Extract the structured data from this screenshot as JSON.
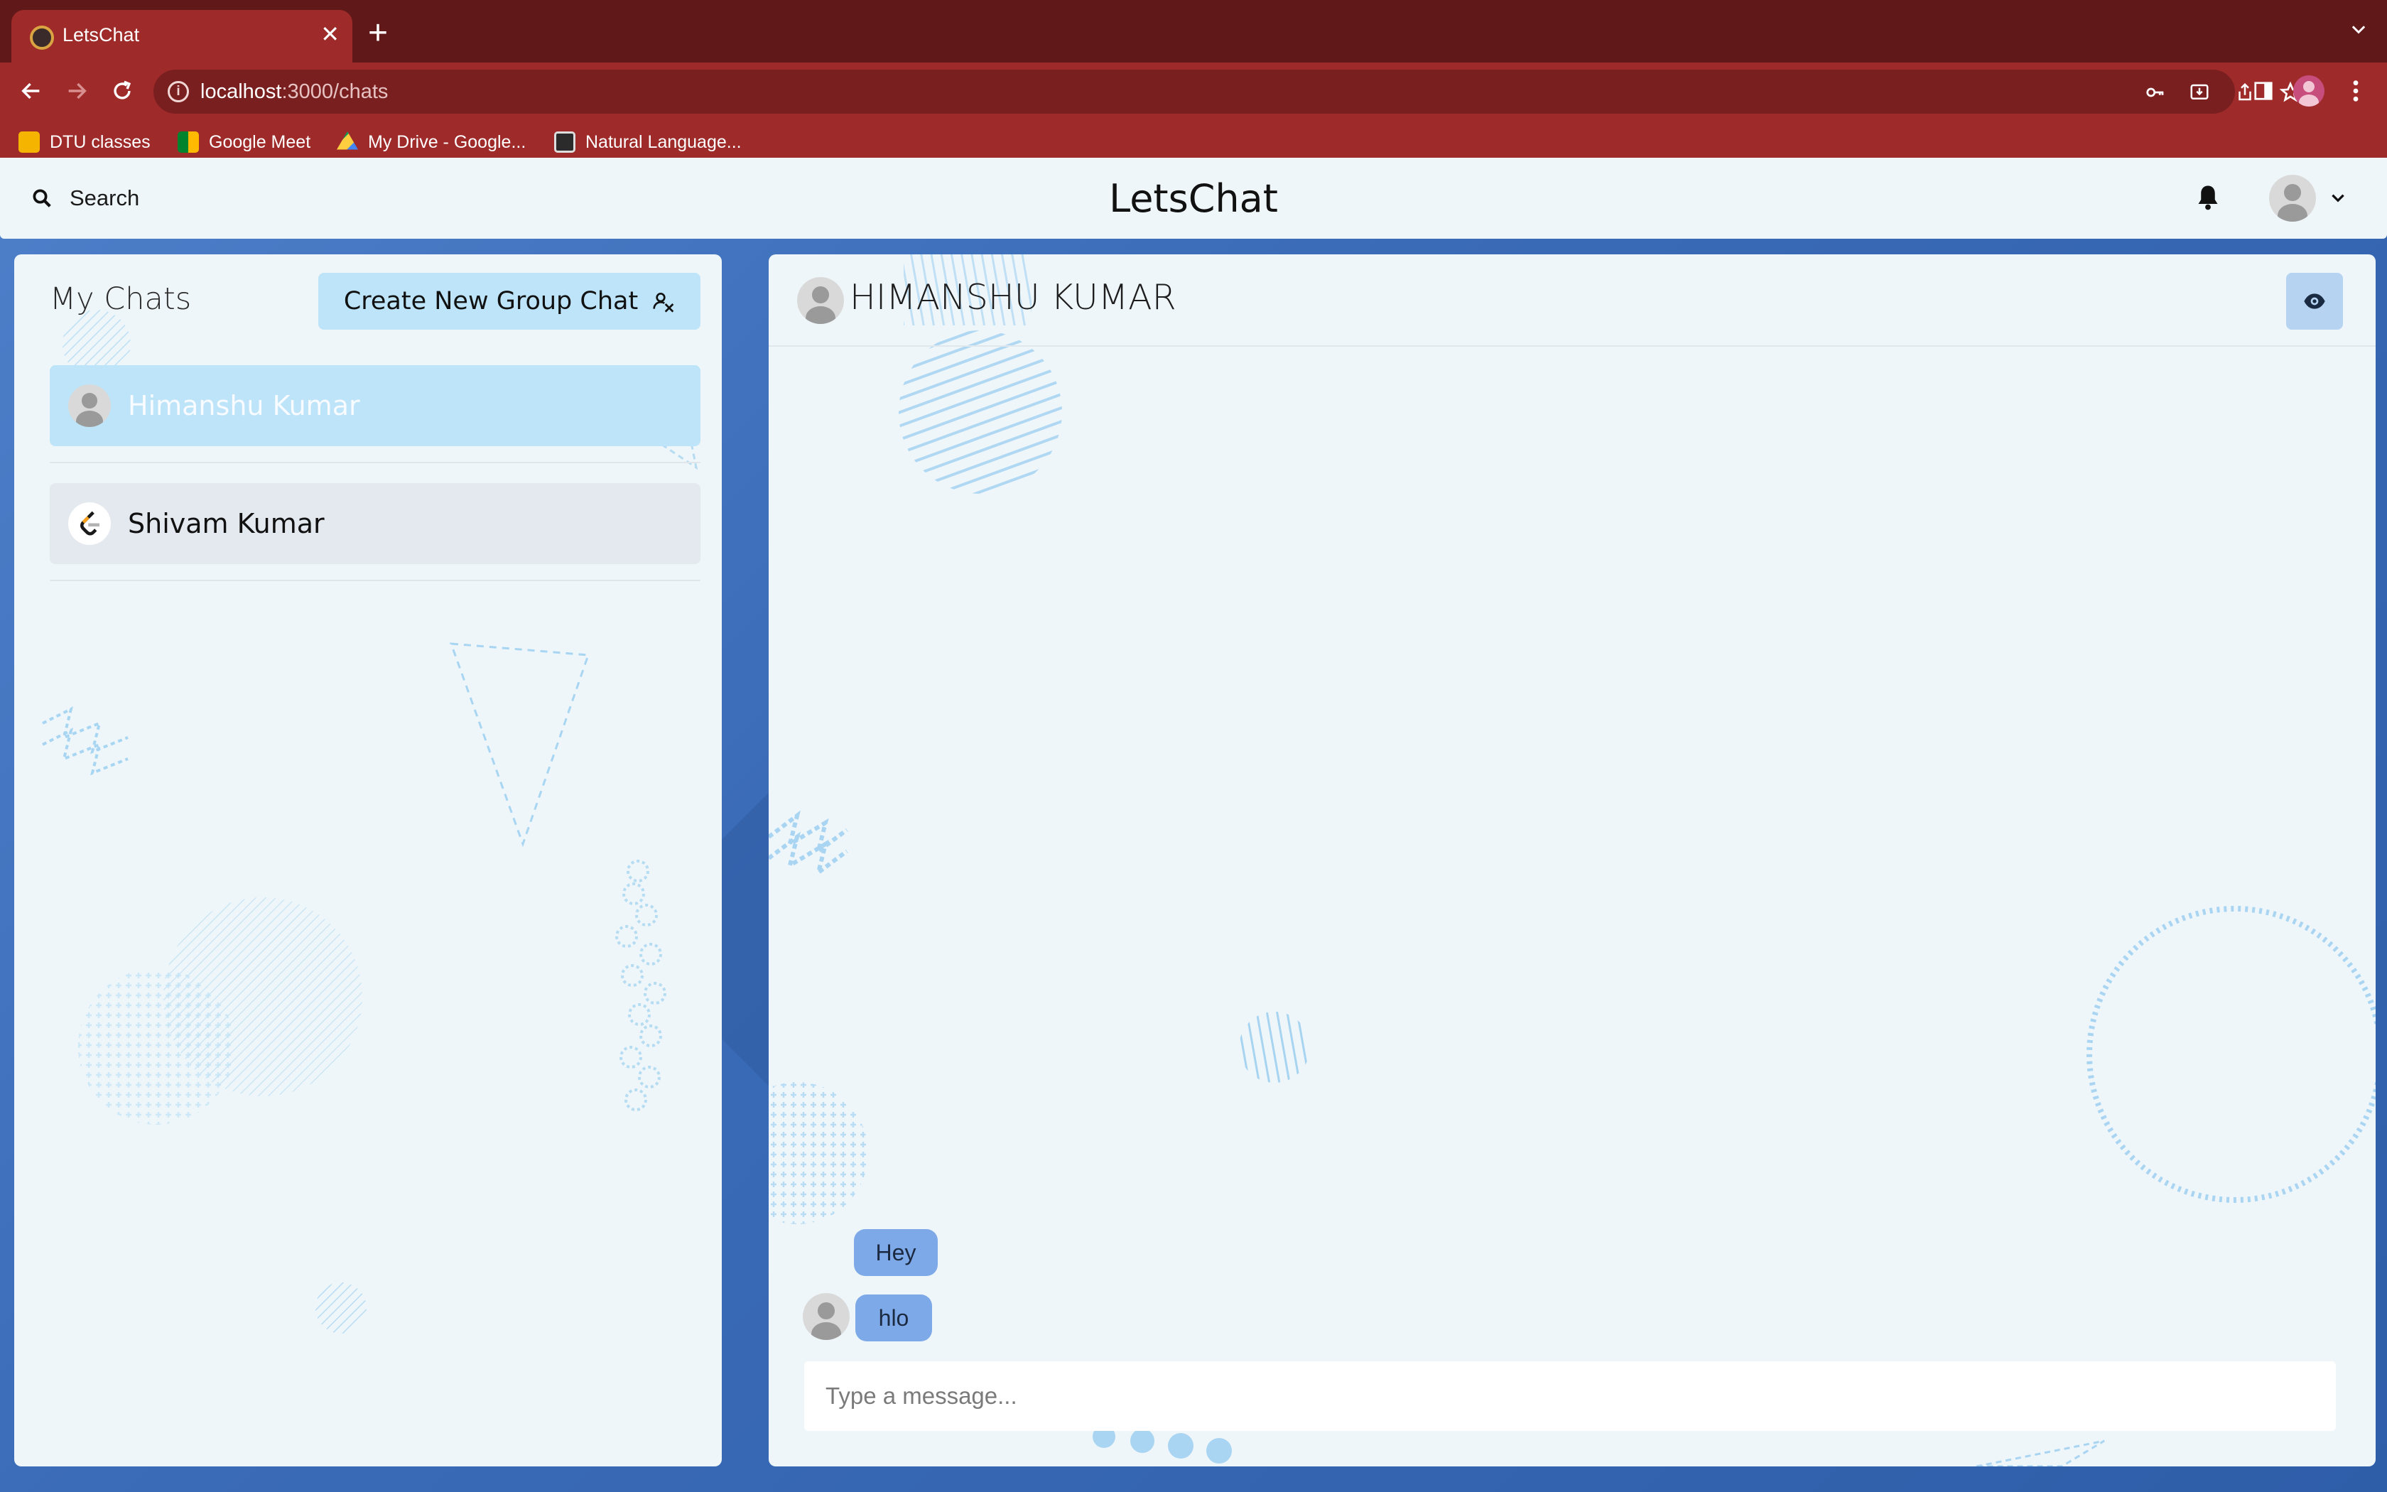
{
  "browser": {
    "tab_title": "LetsChat",
    "url_host": "localhost",
    "url_path": ":3000/chats",
    "bookmarks": [
      "DTU classes",
      "Google Meet",
      "My Drive - Google...",
      "Natural Language..."
    ]
  },
  "header": {
    "search_label": "Search",
    "brand": "LetsChat"
  },
  "sidebar": {
    "title": "My Chats",
    "create_group_label": "Create New Group Chat",
    "chats": [
      {
        "name": "Himanshu Kumar",
        "active": true
      },
      {
        "name": "Shivam Kumar",
        "active": false
      }
    ]
  },
  "chat": {
    "title": "HIMANSHU KUMAR",
    "messages": [
      {
        "text": "Hey"
      },
      {
        "text": "hlo"
      }
    ],
    "input_placeholder": "Type a message..."
  },
  "colors": {
    "tab_strip": "#611818",
    "toolbar": "#9e2a2a",
    "accent_light": "#bde4f8",
    "message_bubble": "#7ea9e8",
    "app_background": "#3a6db3"
  }
}
